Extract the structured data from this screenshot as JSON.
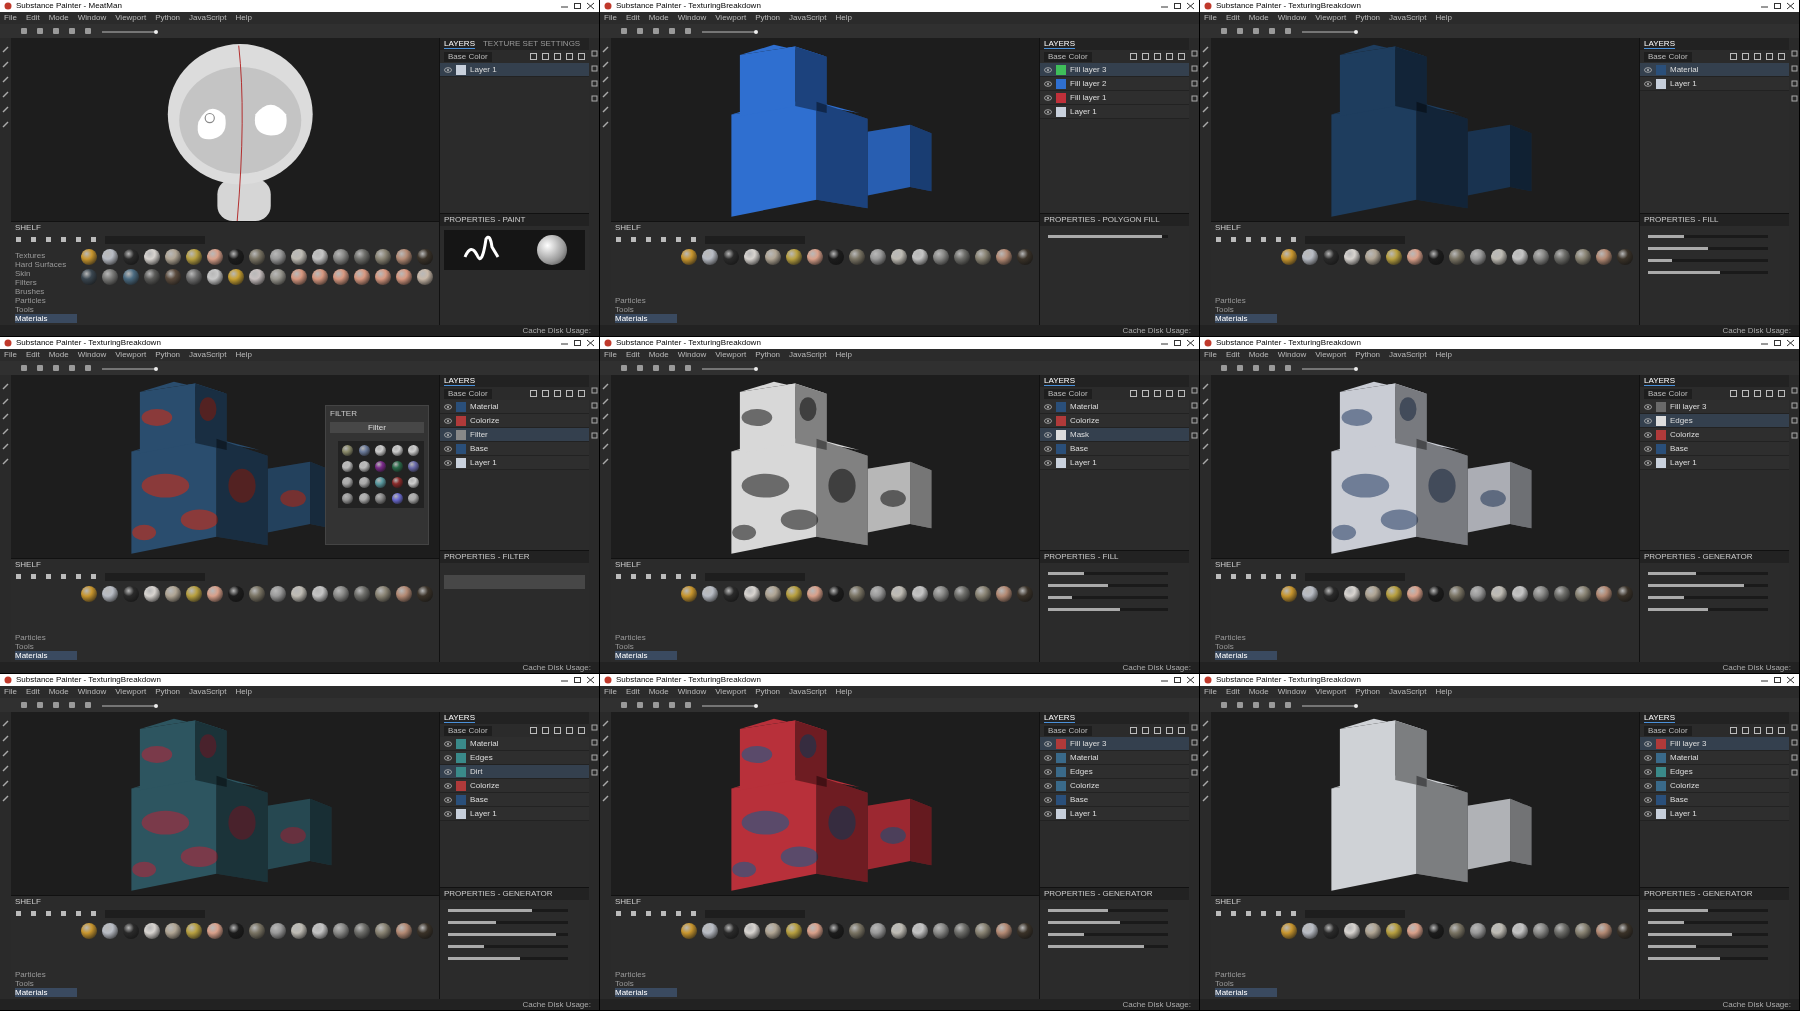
{
  "windows": [
    {
      "title": "Substance Painter - MeatMan",
      "menu": [
        "File",
        "Edit",
        "Mode",
        "Window",
        "Viewport",
        "Python",
        "JavaScript",
        "Help"
      ],
      "layer_tabs": [
        {
          "label": "LAYERS",
          "selected": true
        },
        {
          "label": "TEXTURE SET SETTINGS",
          "selected": false
        }
      ],
      "blend_mode": "Base Color",
      "layers": [
        {
          "name": "Layer 1",
          "selected": true,
          "color": "#c8d0dc"
        }
      ],
      "properties": {
        "title": "PROPERTIES - PAINT",
        "kind": "paint"
      },
      "model": {
        "kind": "character"
      },
      "shelf": {
        "title": "SHELF",
        "kind": "two_rows",
        "categories": [
          {
            "label": "Textures",
            "selected": false
          },
          {
            "label": "Hard Surfaces",
            "selected": false
          },
          {
            "label": "Skin",
            "selected": false
          },
          {
            "label": "Filters",
            "selected": false
          },
          {
            "label": "Brushes",
            "selected": false
          },
          {
            "label": "Particles",
            "selected": false
          },
          {
            "label": "Tools",
            "selected": false
          },
          {
            "label": "Materials",
            "selected": true
          }
        ]
      },
      "status": "Cache Disk Usage:"
    },
    {
      "title": "Substance Painter - TexturingBreakdown",
      "menu": [
        "File",
        "Edit",
        "Mode",
        "Window",
        "Viewport",
        "Python",
        "JavaScript",
        "Help"
      ],
      "layer_tabs": [
        {
          "label": "LAYERS",
          "selected": true
        }
      ],
      "blend_mode": "Base Color",
      "layers": [
        {
          "name": "Fill layer 3",
          "selected": true,
          "color": "#3fbf5a"
        },
        {
          "name": "Fill layer 2",
          "selected": false,
          "color": "#2f6fd0"
        },
        {
          "name": "Fill layer 1",
          "selected": false,
          "color": "#c0303a"
        },
        {
          "name": "Layer 1",
          "selected": false,
          "color": "#c8d0dc"
        }
      ],
      "properties": {
        "title": "PROPERTIES - POLYGON FILL",
        "kind": "sliders",
        "sliders": [
          {
            "level": 0.95
          }
        ]
      },
      "model": {
        "kind": "cubes",
        "color": "#2f6fd0"
      },
      "shelf": {
        "title": "SHELF",
        "kind": "one_row",
        "categories": [
          {
            "label": "Particles",
            "selected": false
          },
          {
            "label": "Tools",
            "selected": false
          },
          {
            "label": "Materials",
            "selected": true
          }
        ]
      },
      "status": "Cache Disk Usage:"
    },
    {
      "title": "Substance Painter - TexturingBreakdown",
      "menu": [
        "File",
        "Edit",
        "Mode",
        "Window",
        "Viewport",
        "Python",
        "JavaScript",
        "Help"
      ],
      "layer_tabs": [
        {
          "label": "LAYERS",
          "selected": true
        }
      ],
      "blend_mode": "Base Color",
      "layers": [
        {
          "name": "Material",
          "selected": true,
          "color": "#2a4f7a"
        },
        {
          "name": "Layer 1",
          "selected": false,
          "color": "#c8d0dc"
        }
      ],
      "properties": {
        "title": "PROPERTIES - FILL",
        "kind": "sliders",
        "sliders": [
          {
            "level": 0.3
          },
          {
            "level": 0.5
          },
          {
            "level": 0.2
          },
          {
            "level": 0.6
          }
        ]
      },
      "model": {
        "kind": "cubes",
        "color": "#1e3d5e"
      },
      "shelf": {
        "title": "SHELF",
        "kind": "one_row",
        "categories": [
          {
            "label": "Particles",
            "selected": false
          },
          {
            "label": "Tools",
            "selected": false
          },
          {
            "label": "Materials",
            "selected": true
          }
        ]
      },
      "status": "Cache Disk Usage:"
    },
    {
      "title": "Substance Painter - TexturingBreakdown",
      "menu": [
        "File",
        "Edit",
        "Mode",
        "Window",
        "Viewport",
        "Python",
        "JavaScript",
        "Help"
      ],
      "layer_tabs": [
        {
          "label": "LAYERS",
          "selected": true
        }
      ],
      "blend_mode": "Base Color",
      "layers": [
        {
          "name": "Material",
          "selected": false,
          "color": "#2a4f7a"
        },
        {
          "name": "Colorize",
          "selected": false,
          "color": "#b03a3a"
        },
        {
          "name": "Filter",
          "selected": true,
          "color": "#888888"
        },
        {
          "name": "Base",
          "selected": false,
          "color": "#2a4f7a"
        },
        {
          "name": "Layer 1",
          "selected": false,
          "color": "#c8d0dc"
        }
      ],
      "properties": {
        "title": "PROPERTIES - FILTER",
        "kind": "filter"
      },
      "model": {
        "kind": "cubes",
        "color": "#2a4d6e",
        "spots": {
          "color": "#8a3a3a"
        }
      },
      "popup": {
        "title": "FILTER",
        "button": "Filter"
      },
      "shelf": {
        "title": "SHELF",
        "kind": "one_row",
        "categories": [
          {
            "label": "Particles",
            "selected": false
          },
          {
            "label": "Tools",
            "selected": false
          },
          {
            "label": "Materials",
            "selected": true
          }
        ]
      },
      "status": "Cache Disk Usage:"
    },
    {
      "title": "Substance Painter - TexturingBreakdown",
      "menu": [
        "File",
        "Edit",
        "Mode",
        "Window",
        "Viewport",
        "Python",
        "JavaScript",
        "Help"
      ],
      "layer_tabs": [
        {
          "label": "LAYERS",
          "selected": true
        }
      ],
      "blend_mode": "Base Color",
      "layers": [
        {
          "name": "Material",
          "selected": false,
          "color": "#2a4f7a"
        },
        {
          "name": "Colorize",
          "selected": false,
          "color": "#b03a3a"
        },
        {
          "name": "Mask",
          "selected": true,
          "color": "#dddddd"
        },
        {
          "name": "Base",
          "selected": false,
          "color": "#2a4f7a"
        },
        {
          "name": "Layer 1",
          "selected": false,
          "color": "#c8d0dc"
        }
      ],
      "properties": {
        "title": "PROPERTIES - FILL",
        "kind": "sliders",
        "sliders": [
          {
            "level": 0.3
          },
          {
            "level": 0.5
          },
          {
            "level": 0.2
          },
          {
            "level": 0.6
          }
        ]
      },
      "model": {
        "kind": "cubes",
        "color": "#d8d8d8",
        "spots": {
          "color": "#6a6a6a"
        }
      },
      "shelf": {
        "title": "SHELF",
        "kind": "one_row",
        "categories": [
          {
            "label": "Particles",
            "selected": false
          },
          {
            "label": "Tools",
            "selected": false
          },
          {
            "label": "Materials",
            "selected": true
          }
        ]
      },
      "status": "Cache Disk Usage:"
    },
    {
      "title": "Substance Painter - TexturingBreakdown",
      "menu": [
        "File",
        "Edit",
        "Mode",
        "Window",
        "Viewport",
        "Python",
        "JavaScript",
        "Help"
      ],
      "layer_tabs": [
        {
          "label": "LAYERS",
          "selected": true
        }
      ],
      "blend_mode": "Base Color",
      "layers": [
        {
          "name": "Fill layer 3",
          "selected": false,
          "color": "#6a6a6a"
        },
        {
          "name": "Edges",
          "selected": true,
          "color": "#dddddd"
        },
        {
          "name": "Colorize",
          "selected": false,
          "color": "#b03a3a"
        },
        {
          "name": "Base",
          "selected": false,
          "color": "#2a4f7a"
        },
        {
          "name": "Layer 1",
          "selected": false,
          "color": "#c8d0dc"
        }
      ],
      "properties": {
        "title": "PROPERTIES - GENERATOR",
        "kind": "sliders",
        "sliders": [
          {
            "level": 0.4
          },
          {
            "level": 0.8
          },
          {
            "level": 0.3
          },
          {
            "level": 0.5
          }
        ]
      },
      "model": {
        "kind": "cubes",
        "color": "#c9ccd4",
        "spots": {
          "color": "#6f7d96"
        }
      },
      "shelf": {
        "title": "SHELF",
        "kind": "one_row",
        "categories": [
          {
            "label": "Particles",
            "selected": false
          },
          {
            "label": "Tools",
            "selected": false
          },
          {
            "label": "Materials",
            "selected": true
          }
        ]
      },
      "status": "Cache Disk Usage:"
    },
    {
      "title": "Substance Painter - TexturingBreakdown",
      "menu": [
        "File",
        "Edit",
        "Mode",
        "Window",
        "Viewport",
        "Python",
        "JavaScript",
        "Help"
      ],
      "layer_tabs": [
        {
          "label": "LAYERS",
          "selected": true
        }
      ],
      "blend_mode": "Base Color",
      "layers": [
        {
          "name": "Material",
          "selected": false,
          "color": "#3a8a8a"
        },
        {
          "name": "Edges",
          "selected": false,
          "color": "#3a8a8a"
        },
        {
          "name": "Dirt",
          "selected": true,
          "color": "#3a8a8a"
        },
        {
          "name": "Colorize",
          "selected": false,
          "color": "#b03a3a"
        },
        {
          "name": "Base",
          "selected": false,
          "color": "#2a4f7a"
        },
        {
          "name": "Layer 1",
          "selected": false,
          "color": "#c8d0dc"
        }
      ],
      "properties": {
        "title": "PROPERTIES - GENERATOR",
        "kind": "sliders",
        "sliders": [
          {
            "level": 0.7
          },
          {
            "level": 0.4
          },
          {
            "level": 0.9
          },
          {
            "level": 0.3
          },
          {
            "level": 0.6
          }
        ]
      },
      "model": {
        "kind": "cubes",
        "color": "#2d5560",
        "spots": {
          "color": "#7a3a4a"
        }
      },
      "shelf": {
        "title": "SHELF",
        "kind": "one_row",
        "categories": [
          {
            "label": "Particles",
            "selected": false
          },
          {
            "label": "Tools",
            "selected": false
          },
          {
            "label": "Materials",
            "selected": true
          }
        ]
      },
      "status": "Cache Disk Usage:"
    },
    {
      "title": "Substance Painter - TexturingBreakdown",
      "menu": [
        "File",
        "Edit",
        "Mode",
        "Window",
        "Viewport",
        "Python",
        "JavaScript",
        "Help"
      ],
      "layer_tabs": [
        {
          "label": "LAYERS",
          "selected": true
        }
      ],
      "blend_mode": "Base Color",
      "layers": [
        {
          "name": "Fill layer 3",
          "selected": true,
          "color": "#b03a3a"
        },
        {
          "name": "Material",
          "selected": false,
          "color": "#3a6a8a"
        },
        {
          "name": "Edges",
          "selected": false,
          "color": "#3a6a8a"
        },
        {
          "name": "Colorize",
          "selected": false,
          "color": "#3a6a8a"
        },
        {
          "name": "Base",
          "selected": false,
          "color": "#2a4f7a"
        },
        {
          "name": "Layer 1",
          "selected": false,
          "color": "#c8d0dc"
        }
      ],
      "properties": {
        "title": "PROPERTIES - GENERATOR",
        "kind": "sliders",
        "sliders": [
          {
            "level": 0.5
          },
          {
            "level": 0.6
          },
          {
            "level": 0.3
          },
          {
            "level": 0.8
          }
        ]
      },
      "model": {
        "kind": "cubes",
        "color": "#b8303a",
        "spots": {
          "color": "#5a4a6a"
        }
      },
      "shelf": {
        "title": "SHELF",
        "kind": "one_row",
        "categories": [
          {
            "label": "Particles",
            "selected": false
          },
          {
            "label": "Tools",
            "selected": false
          },
          {
            "label": "Materials",
            "selected": true
          }
        ]
      },
      "status": "Cache Disk Usage:"
    },
    {
      "title": "Substance Painter - TexturingBreakdown",
      "menu": [
        "File",
        "Edit",
        "Mode",
        "Window",
        "Viewport",
        "Python",
        "JavaScript",
        "Help"
      ],
      "layer_tabs": [
        {
          "label": "LAYERS",
          "selected": true
        }
      ],
      "blend_mode": "Base Color",
      "layers": [
        {
          "name": "Fill layer 3",
          "selected": true,
          "color": "#b03a3a"
        },
        {
          "name": "Material",
          "selected": false,
          "color": "#3a6a8a"
        },
        {
          "name": "Edges",
          "selected": false,
          "color": "#3a8a8a"
        },
        {
          "name": "Colorize",
          "selected": false,
          "color": "#3a6a8a"
        },
        {
          "name": "Base",
          "selected": false,
          "color": "#2a4f7a"
        },
        {
          "name": "Layer 1",
          "selected": false,
          "color": "#c8d0dc"
        }
      ],
      "properties": {
        "title": "PROPERTIES - GENERATOR",
        "kind": "sliders",
        "sliders": [
          {
            "level": 0.5
          },
          {
            "level": 0.3
          },
          {
            "level": 0.7
          },
          {
            "level": 0.4
          },
          {
            "level": 0.6
          }
        ]
      },
      "model": {
        "kind": "cubes",
        "color": "#cfd2d6"
      },
      "shelf": {
        "title": "SHELF",
        "kind": "one_row",
        "categories": [
          {
            "label": "Particles",
            "selected": false
          },
          {
            "label": "Tools",
            "selected": false
          },
          {
            "label": "Materials",
            "selected": true
          }
        ]
      },
      "status": "Cache Disk Usage:"
    }
  ]
}
